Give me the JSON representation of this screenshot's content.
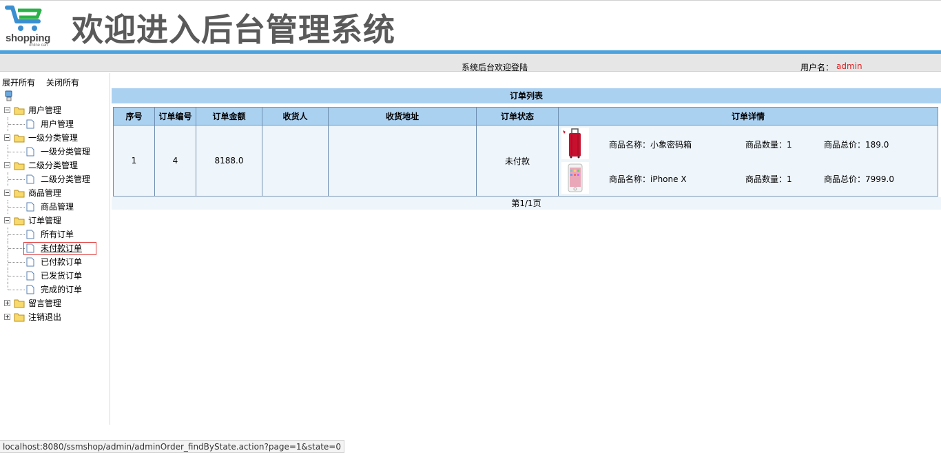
{
  "header": {
    "brand": "shopping",
    "brand_sub": "online cart",
    "title": "欢迎进入后台管理系统"
  },
  "welcome_bar": {
    "text": "系统后台欢迎登陆",
    "user_label": "用户名：",
    "user_name": "admin"
  },
  "sidebar": {
    "expand_all": "展开所有",
    "collapse_all": "关闭所有",
    "groups": [
      {
        "label": "用户管理",
        "children": [
          "用户管理"
        ]
      },
      {
        "label": "一级分类管理",
        "children": [
          "一级分类管理"
        ]
      },
      {
        "label": "二级分类管理",
        "children": [
          "二级分类管理"
        ]
      },
      {
        "label": "商品管理",
        "children": [
          "商品管理"
        ]
      },
      {
        "label": "订单管理",
        "children": [
          "所有订单",
          "未付款订单",
          "已付款订单",
          "已发货订单",
          "完成的订单"
        ]
      },
      {
        "label": "留言管理",
        "children": []
      },
      {
        "label": "注销退出",
        "children": []
      }
    ],
    "selected_item": "未付款订单"
  },
  "main": {
    "list_title": "订单列表",
    "columns": [
      "序号",
      "订单编号",
      "订单金额",
      "收货人",
      "收货地址",
      "订单状态",
      "订单详情"
    ],
    "rows": [
      {
        "index": "1",
        "order_no": "4",
        "amount": "8188.0",
        "receiver": "",
        "address": "",
        "status": "未付款",
        "items": [
          {
            "name": "商品名称：小象密码箱",
            "qty": "商品数量：1",
            "total": "商品总价：189.0",
            "thumb": "luggage-thumbnail"
          },
          {
            "name": "商品名称：iPhone X",
            "qty": "商品数量：1",
            "total": "商品总价：7999.0",
            "thumb": "phone-thumbnail"
          }
        ]
      }
    ],
    "pager": "第1/1页"
  },
  "statusbar": {
    "url": "localhost:8080/ssmshop/admin/adminOrder_findByState.action?page=1&state=0"
  },
  "colors": {
    "header_line": "#4aa3df",
    "table_header": "#abd1f1",
    "username": "#e02020",
    "selected_border": "#e04040"
  }
}
